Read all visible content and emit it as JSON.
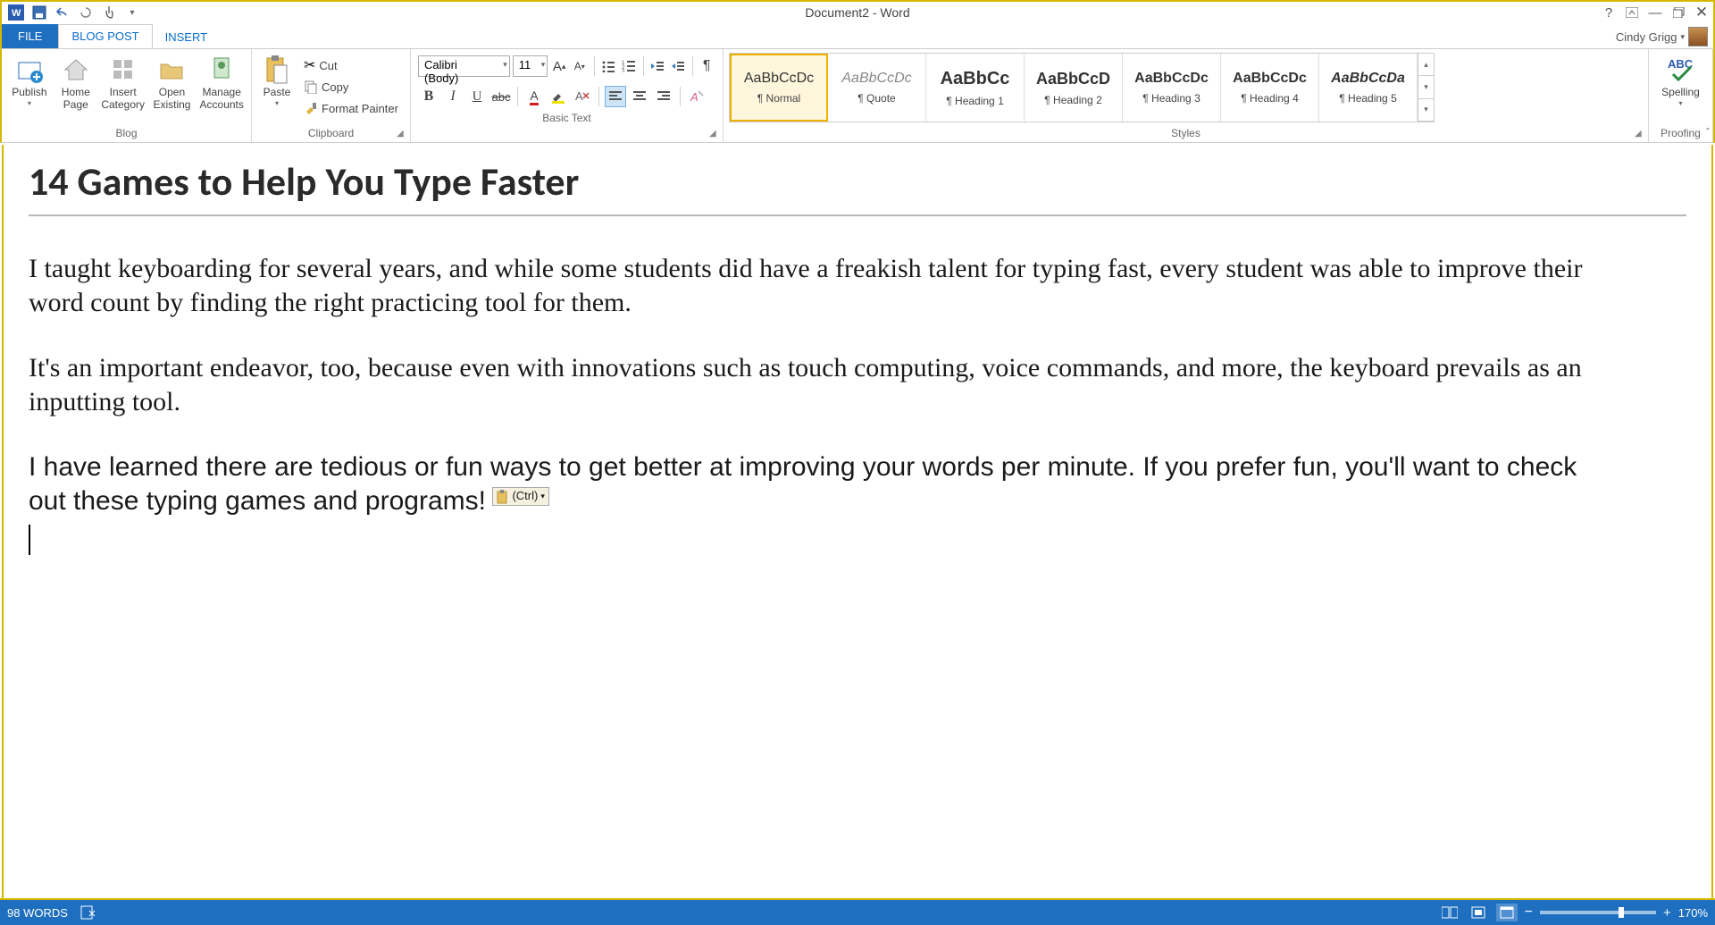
{
  "title": "Document2 - Word",
  "user": "Cindy Grigg",
  "tabs": {
    "file": "FILE",
    "blogpost": "BLOG POST",
    "insert": "INSERT"
  },
  "ribbon": {
    "blog": {
      "label": "Blog",
      "publish": "Publish",
      "homepage": "Home Page",
      "insertcat": "Insert Category",
      "openexisting": "Open Existing",
      "manageacc": "Manage Accounts"
    },
    "clipboard": {
      "label": "Clipboard",
      "paste": "Paste",
      "cut": "Cut",
      "copy": "Copy",
      "format": "Format Painter"
    },
    "basictext": {
      "label": "Basic Text",
      "font": "Calibri (Body)",
      "size": "11"
    },
    "styles": {
      "label": "Styles",
      "items": [
        {
          "preview": "AaBbCcDc",
          "name": "¶ Normal"
        },
        {
          "preview": "AaBbCcDc",
          "name": "¶ Quote"
        },
        {
          "preview": "AaBbCc",
          "name": "¶ Heading 1"
        },
        {
          "preview": "AaBbCcD",
          "name": "¶ Heading 2"
        },
        {
          "preview": "AaBbCcDc",
          "name": "¶ Heading 3"
        },
        {
          "preview": "AaBbCcDc",
          "name": "¶ Heading 4"
        },
        {
          "preview": "AaBbCcDa",
          "name": "¶ Heading 5"
        }
      ]
    },
    "proofing": {
      "label": "Proofing",
      "spelling": "Spelling"
    }
  },
  "document": {
    "heading": "14 Games to Help You Type Faster",
    "p1": "I taught keyboarding for several years, and while some students did have a freakish talent for typing fast, every student was able to improve their word count by finding the right practicing tool for them.",
    "p2": "It's an important endeavor, too, because even with innovations such as touch computing, voice commands, and more, the keyboard prevails as an inputting tool.",
    "p3": "I have learned there are tedious or fun ways to get better at improving your words per minute. If you prefer fun, you'll want to check out these typing games and programs!",
    "pasteopts": "(Ctrl)"
  },
  "status": {
    "words": "98 WORDS",
    "zoom": "170%"
  }
}
